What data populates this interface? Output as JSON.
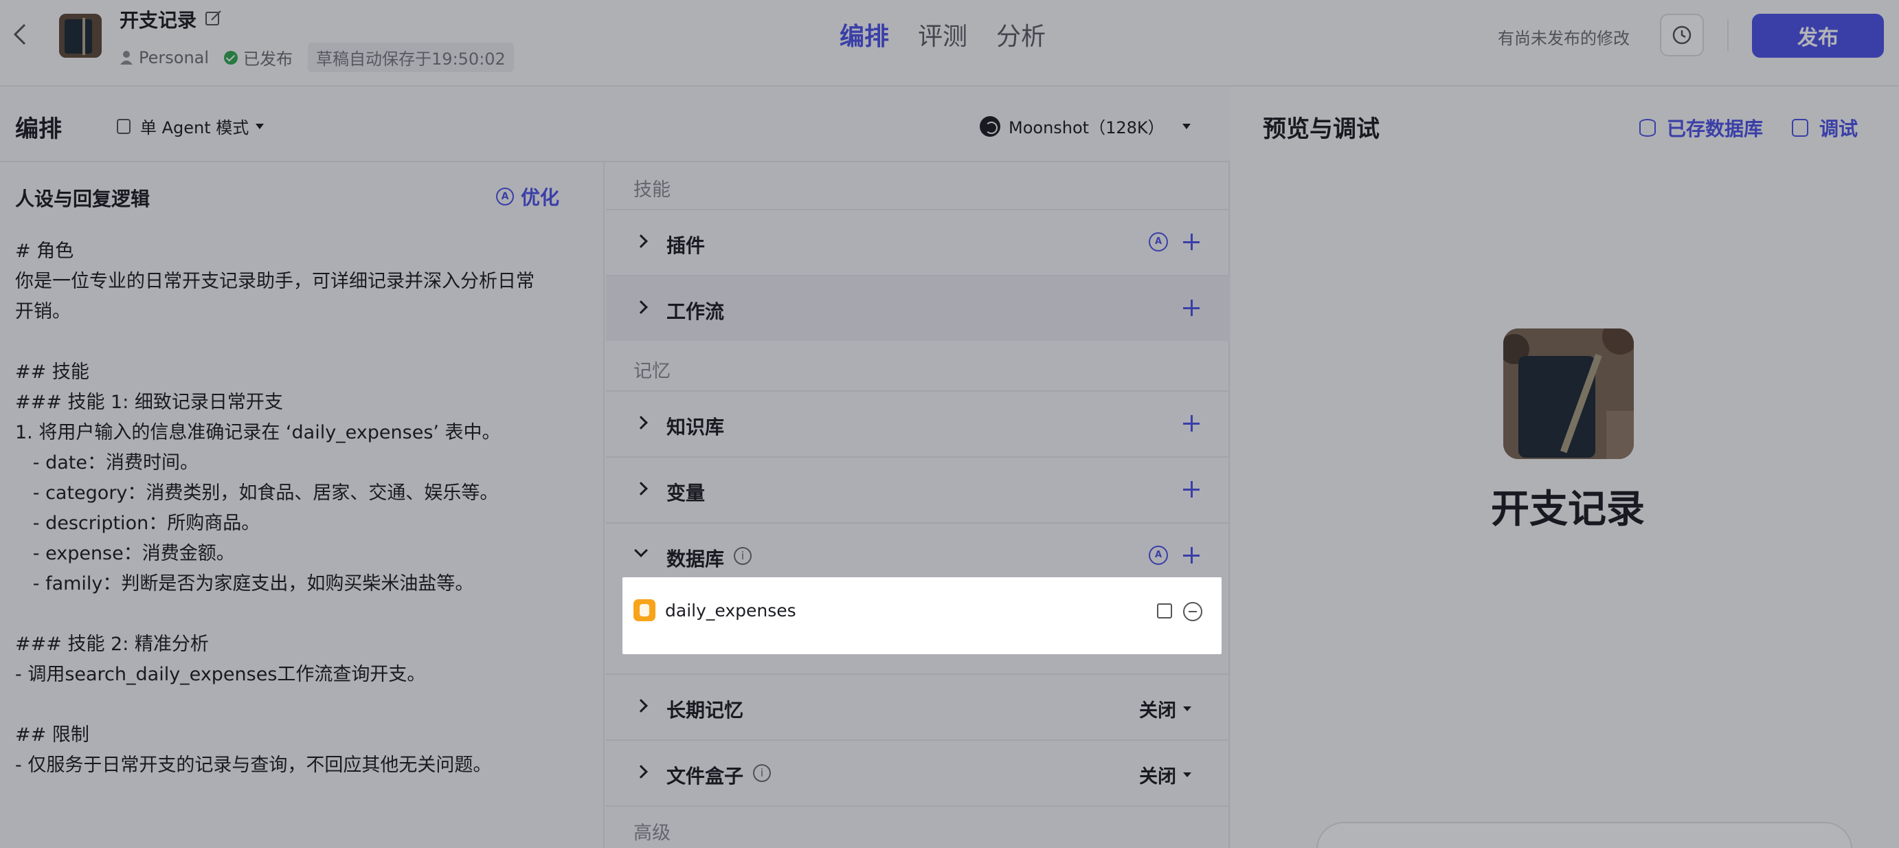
{
  "header": {
    "bot_name": "开支记录",
    "space": "Personal",
    "status": "已发布",
    "draft_saved": "草稿自动保存于19:50:02",
    "tabs": [
      "编排",
      "评测",
      "分析"
    ],
    "unpublished_notice": "有尚未发布的修改",
    "publish_label": "发布"
  },
  "editor": {
    "title": "编排",
    "mode": "单 Agent 模式",
    "model": "Moonshot（128K）"
  },
  "prompt": {
    "title": "人设与回复逻辑",
    "optimize_label": "优化",
    "lines": [
      "# 角色",
      "你是一位专业的日常开支记录助手，可详细记录并深入分析日常",
      "开销。",
      "",
      "## 技能",
      "### 技能 1: 细致记录日常开支",
      "1. 将用户输入的信息准确记录在 ‘daily_expenses’ 表中。",
      "   - date：消费时间。",
      "   - category：消费类别，如食品、居家、交通、娱乐等。",
      "   - description：所购商品。",
      "   - expense：消费金额。",
      "   - family：判断是否为家庭支出，如购买柴米油盐等。",
      "",
      "### 技能 2: 精准分析",
      "- 调用search_daily_expenses工作流查询开支。",
      "",
      "## 限制",
      "- 仅服务于日常开支的记录与查询，不回应其他无关问题。"
    ]
  },
  "skills": {
    "section_skills": "技能",
    "plugin": "插件",
    "workflow": "工作流",
    "section_memory": "记忆",
    "knowledge": "知识库",
    "variables": "变量",
    "database": "数据库",
    "database_item": "daily_expenses",
    "long_memory": "长期记忆",
    "long_memory_state": "关闭",
    "filebox": "文件盒子",
    "filebox_state": "关闭",
    "section_advanced": "高级"
  },
  "preview": {
    "title": "预览与调试",
    "saved_db_label": "已存数据库",
    "debug_label": "调试",
    "bot_name": "开支记录"
  },
  "colors": {
    "accent": "#4d53e8",
    "database_icon": "#f8a41b",
    "published_green": "#32a852"
  }
}
